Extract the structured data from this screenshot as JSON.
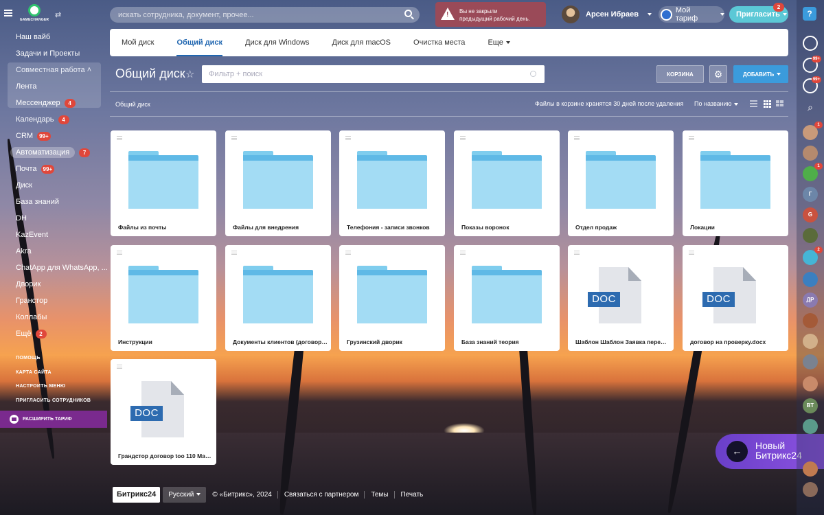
{
  "topbar": {
    "logo_text": "GAMECHANGER",
    "search_placeholder": "искать сотрудника, документ, прочее...",
    "warning_line1": "Вы не закрыли",
    "warning_line2": "предыдущий рабочий день.",
    "user_name": "Арсен Ибраев",
    "tariff_label": "Мой тариф",
    "invite_label": "Пригласить",
    "invite_badge": "2"
  },
  "leftmenu": {
    "items": [
      {
        "label": "Наш вайб"
      },
      {
        "label": "Задачи и Проекты"
      },
      {
        "label": "Совместная работа"
      },
      {
        "label": "Лента"
      },
      {
        "label": "Мессенджер",
        "badge": "4"
      },
      {
        "label": "Календарь",
        "badge": "4"
      },
      {
        "label": "CRM",
        "badge": "99+"
      },
      {
        "label": "Автоматизация",
        "badge": "7"
      },
      {
        "label": "Почта",
        "badge": "99+"
      },
      {
        "label": "Диск"
      },
      {
        "label": "База знаний"
      },
      {
        "label": "DH"
      },
      {
        "label": "KazEvent"
      },
      {
        "label": "Akra"
      },
      {
        "label": "ChatApp для WhatsApp, ..."
      },
      {
        "label": "Дворик"
      },
      {
        "label": "Гранстор"
      },
      {
        "label": "Коллабы"
      },
      {
        "label": "Ещё",
        "badge": "2"
      }
    ],
    "help": "ПОМОЩЬ",
    "sitemap": "КАРТА САЙТА",
    "configure": "НАСТРОИТЬ МЕНЮ",
    "invite_staff": "ПРИГЛАСИТЬ СОТРУДНИКОВ",
    "expand_tariff": "РАСШИРИТЬ ТАРИФ"
  },
  "tabs": [
    {
      "label": "Мой диск",
      "active": false
    },
    {
      "label": "Общий диск",
      "active": true
    },
    {
      "label": "Диск для Windows",
      "active": false
    },
    {
      "label": "Диск для macOS",
      "active": false
    },
    {
      "label": "Очистка места",
      "active": false
    },
    {
      "label": "Еще",
      "active": false
    }
  ],
  "page": {
    "title": "Общий диск",
    "filter_placeholder": "Фильтр + поиск",
    "trash_label": "КОРЗИНА",
    "add_label": "ДОБАВИТЬ",
    "breadcrumb": "Общий диск",
    "trash_info": "Файлы в корзине хранятся 30 дней после удаления",
    "sort_label": "По названию"
  },
  "files": [
    {
      "name": "Файлы из почты",
      "type": "folder"
    },
    {
      "name": "Файлы для внедрения",
      "type": "folder"
    },
    {
      "name": "Телефония - записи звонков",
      "type": "folder"
    },
    {
      "name": "Показы воронок",
      "type": "folder"
    },
    {
      "name": "Отдел продаж",
      "type": "folder"
    },
    {
      "name": "Локации",
      "type": "folder"
    },
    {
      "name": "Инструкции",
      "type": "folder"
    },
    {
      "name": "Документы клиентов (договоры...",
      "type": "folder"
    },
    {
      "name": "Грузинский дворик",
      "type": "folder"
    },
    {
      "name": "База знаний теория",
      "type": "folder"
    },
    {
      "name": "Шаблон Шаблон Заявка перемещ...",
      "type": "doc",
      "ext": "DOC"
    },
    {
      "name": "договор на проверку.docx",
      "type": "doc",
      "ext": "DOC"
    },
    {
      "name": "Грандстор договор too 110 Мар...",
      "type": "doc",
      "ext": "DOC"
    }
  ],
  "footer": {
    "brand": "Битрикс24",
    "lang": "Русский",
    "copyright": "© «Битрикс», 2024",
    "partner": "Связаться с партнером",
    "themes": "Темы",
    "print": "Печать"
  },
  "promo": {
    "line1": "Новый",
    "line2": "Битрикс24"
  },
  "rightbar": {
    "help": "?",
    "badges": [
      "99+",
      "99+",
      "1",
      "1",
      "2"
    ],
    "letters": [
      "Г",
      "G",
      "ДР",
      "BT"
    ]
  },
  "colors": {
    "accent": "#2066b0",
    "add_button": "#3b9bdc",
    "folder": "#a3dcf4",
    "badge": "#e0473b"
  }
}
